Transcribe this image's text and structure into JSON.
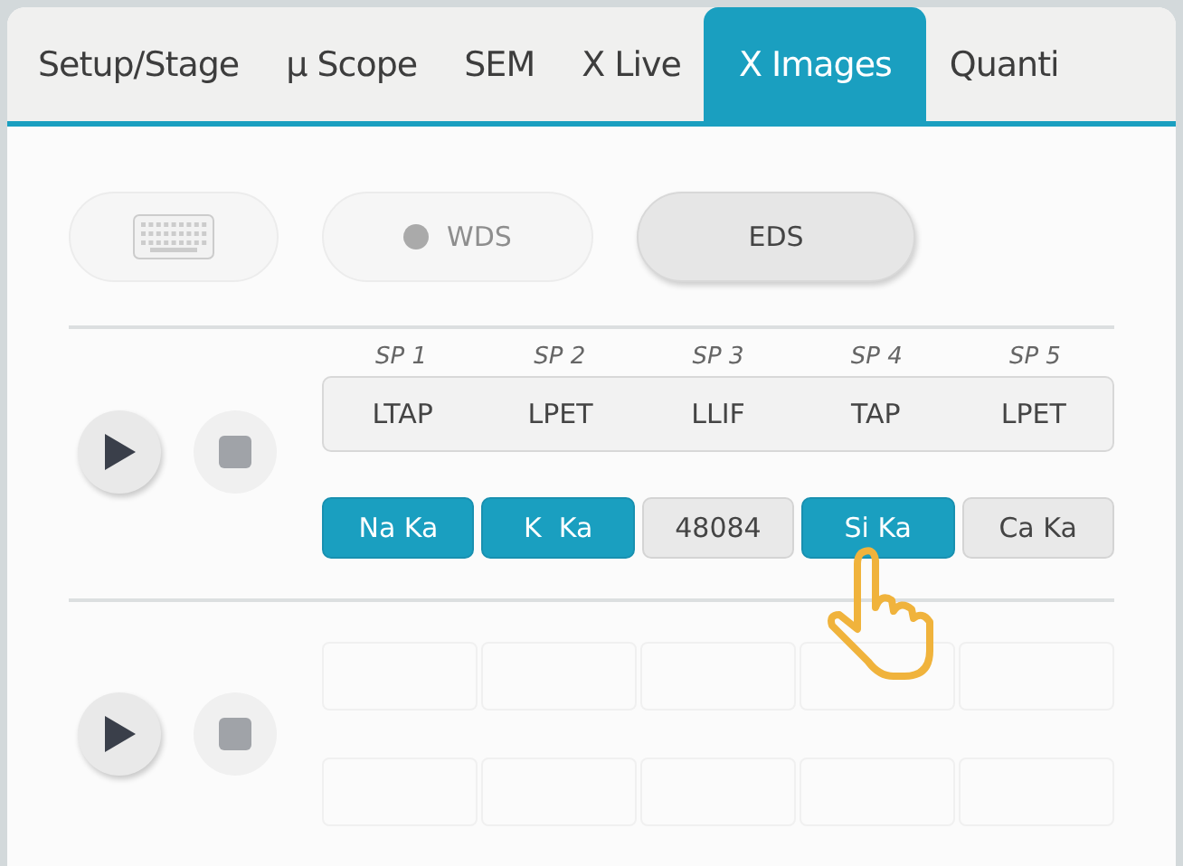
{
  "tabs": [
    {
      "label": "Setup/Stage",
      "selected": false
    },
    {
      "label": "µ Scope",
      "selected": false
    },
    {
      "label": "SEM",
      "selected": false
    },
    {
      "label": "X Live",
      "selected": false
    },
    {
      "label": "X Images",
      "selected": true
    },
    {
      "label": "Quanti",
      "selected": false
    }
  ],
  "mode_buttons": [
    {
      "kind": "keyboard",
      "disabled": true
    },
    {
      "kind": "indicator",
      "label": "WDS",
      "disabled": true
    },
    {
      "kind": "text",
      "label": "EDS",
      "disabled": false
    }
  ],
  "rows": [
    {
      "kind": "filled",
      "spectrometers": [
        {
          "label": "SP 1",
          "crystal": "LTAP",
          "element": "Na Ka",
          "selected": true
        },
        {
          "label": "SP 2",
          "crystal": "LPET",
          "element": "K  Ka",
          "selected": true
        },
        {
          "label": "SP 3",
          "crystal": "LLIF",
          "element": "48084",
          "selected": false
        },
        {
          "label": "SP 4",
          "crystal": "TAP",
          "element": "Si Ka",
          "selected": true
        },
        {
          "label": "SP 5",
          "crystal": "LPET",
          "element": "Ca Ka",
          "selected": false
        }
      ]
    },
    {
      "kind": "empty"
    }
  ]
}
